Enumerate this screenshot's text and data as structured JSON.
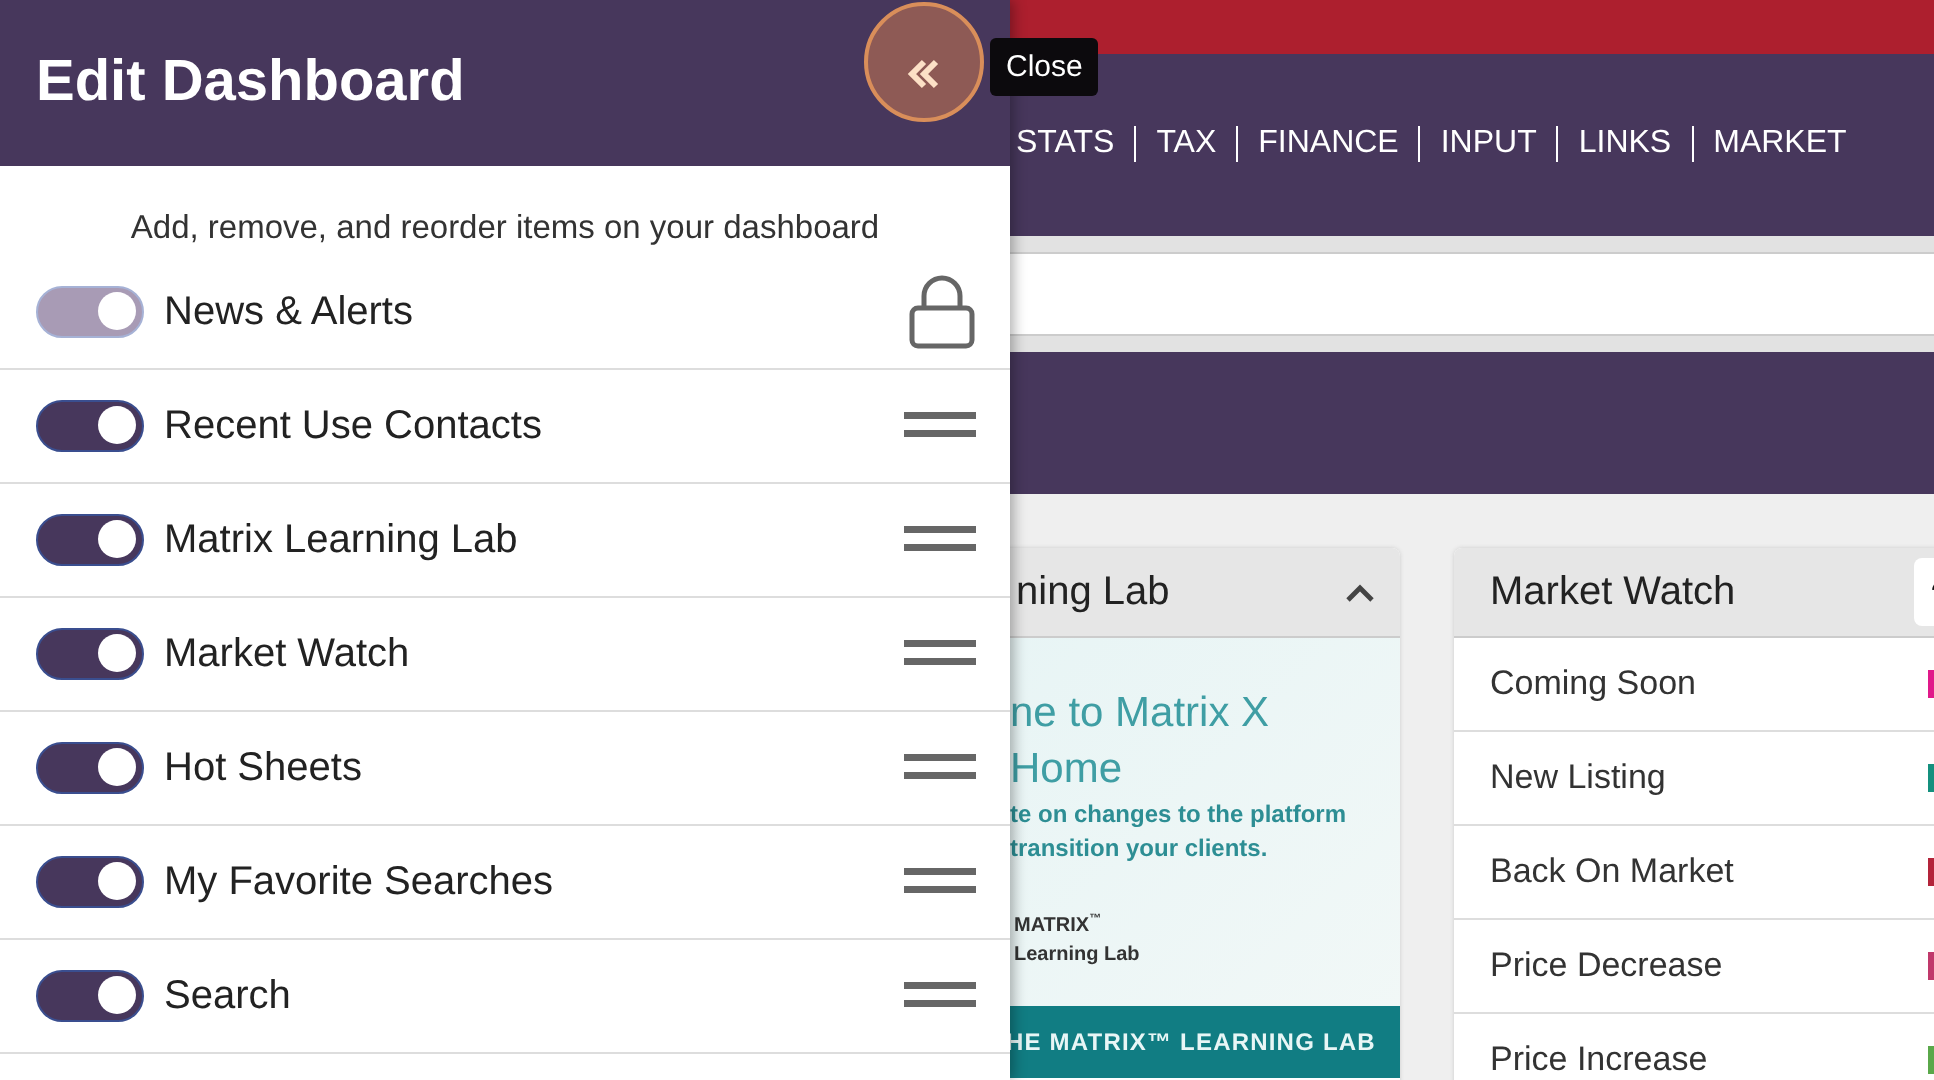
{
  "nav": {
    "links": [
      "STATS",
      "TAX",
      "FINANCE",
      "INPUT",
      "LINKS",
      "MARKET"
    ]
  },
  "learning_card": {
    "title": "ning Lab",
    "banner": {
      "heading_1": "ne to Matrix X",
      "heading_2": "Home",
      "line_1": "te on changes to the platform",
      "line_2": "transition your clients.",
      "logo_1": "MATRIX",
      "logo_mark": "™",
      "logo_2": "Learning Lab",
      "footer": "HE MATRIX™ LEARNING LAB"
    }
  },
  "market_watch": {
    "title": "Market Watch",
    "rows": [
      {
        "label": "Coming Soon",
        "color": "#e0198a"
      },
      {
        "label": "New Listing",
        "color": "#14907e"
      },
      {
        "label": "Back On Market",
        "color": "#b3243a"
      },
      {
        "label": "Price Decrease",
        "color": "#c0396b"
      },
      {
        "label": "Price Increase",
        "color": "#5aa84a"
      }
    ]
  },
  "panel": {
    "title": "Edit Dashboard",
    "close_tooltip": "Close",
    "subtitle": "Add, remove, and reorder items on your dashboard",
    "items": [
      {
        "label": "News & Alerts",
        "on": true,
        "kind": "locked"
      },
      {
        "label": "Recent Use Contacts",
        "on": true,
        "kind": "movable"
      },
      {
        "label": "Matrix Learning Lab",
        "on": true,
        "kind": "movable"
      },
      {
        "label": "Market Watch",
        "on": true,
        "kind": "movable"
      },
      {
        "label": "Hot Sheets",
        "on": true,
        "kind": "movable"
      },
      {
        "label": "My Favorite Searches",
        "on": true,
        "kind": "movable"
      },
      {
        "label": "Search",
        "on": true,
        "kind": "movable"
      }
    ]
  }
}
